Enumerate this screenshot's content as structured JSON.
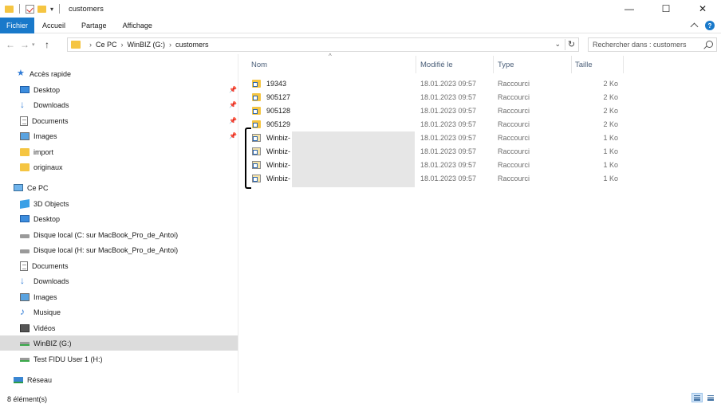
{
  "window": {
    "title": "customers",
    "minimize": "—",
    "maximize": "☐",
    "close": "✕"
  },
  "ribbon": {
    "tabs": [
      {
        "label": "Fichier",
        "active": true
      },
      {
        "label": "Accueil"
      },
      {
        "label": "Partage"
      },
      {
        "label": "Affichage"
      }
    ],
    "help": "?"
  },
  "address": {
    "breadcrumb": [
      "Ce PC",
      "WinBIZ (G:)",
      "customers"
    ]
  },
  "search": {
    "placeholder": "Rechercher dans : customers"
  },
  "sidebar": {
    "quick_access": "Accès rapide",
    "quick_items": [
      {
        "label": "Desktop",
        "icon": "desktop-icon",
        "pinned": true
      },
      {
        "label": "Downloads",
        "icon": "download-icon",
        "pinned": true
      },
      {
        "label": "Documents",
        "icon": "documents-icon",
        "pinned": true
      },
      {
        "label": "Images",
        "icon": "images-icon",
        "pinned": true
      },
      {
        "label": "import",
        "icon": "folder-icon"
      },
      {
        "label": "originaux",
        "icon": "folder-icon"
      }
    ],
    "this_pc": "Ce PC",
    "pc_items": [
      {
        "label": "3D Objects",
        "icon": "3d-objects-icon"
      },
      {
        "label": "Desktop",
        "icon": "desktop-icon"
      },
      {
        "label": "Disque local (C: sur MacBook_Pro_de_Antoi)",
        "icon": "drive-icon"
      },
      {
        "label": "Disque local (H: sur MacBook_Pro_de_Antoi)",
        "icon": "drive-icon"
      },
      {
        "label": "Documents",
        "icon": "documents-icon"
      },
      {
        "label": "Downloads",
        "icon": "download-icon"
      },
      {
        "label": "Images",
        "icon": "images-icon"
      },
      {
        "label": "Musique",
        "icon": "music-icon"
      },
      {
        "label": "Vidéos",
        "icon": "videos-icon"
      },
      {
        "label": "WinBIZ (G:)",
        "icon": "network-drive-icon",
        "selected": true
      },
      {
        "label": "Test FIDU User 1 (H:)",
        "icon": "network-drive-icon"
      }
    ],
    "network": "Réseau"
  },
  "columns": {
    "name": "Nom",
    "modified": "Modifié le",
    "type": "Type",
    "size": "Taille"
  },
  "files": [
    {
      "name": "19343",
      "modified": "18.01.2023 09:57",
      "type": "Raccourci",
      "size": "2 Ko",
      "icon": "folder-shortcut-icon"
    },
    {
      "name": "905127",
      "modified": "18.01.2023 09:57",
      "type": "Raccourci",
      "size": "2 Ko",
      "icon": "folder-shortcut-icon"
    },
    {
      "name": "905128",
      "modified": "18.01.2023 09:57",
      "type": "Raccourci",
      "size": "2 Ko",
      "icon": "folder-shortcut-icon"
    },
    {
      "name": "905129",
      "modified": "18.01.2023 09:57",
      "type": "Raccourci",
      "size": "2 Ko",
      "icon": "folder-shortcut-icon"
    },
    {
      "name": "Winbiz-",
      "modified": "18.01.2023 09:57",
      "type": "Raccourci",
      "size": "1 Ko",
      "icon": "app-shortcut-icon"
    },
    {
      "name": "Winbiz-",
      "modified": "18.01.2023 09:57",
      "type": "Raccourci",
      "size": "1 Ko",
      "icon": "app-shortcut-icon"
    },
    {
      "name": "Winbiz-",
      "modified": "18.01.2023 09:57",
      "type": "Raccourci",
      "size": "1 Ko",
      "icon": "app-shortcut-icon"
    },
    {
      "name": "Winbiz-",
      "modified": "18.01.2023 09:57",
      "type": "Raccourci",
      "size": "1 Ko",
      "icon": "app-shortcut-icon"
    }
  ],
  "status": {
    "count": "8 élément(s)"
  }
}
